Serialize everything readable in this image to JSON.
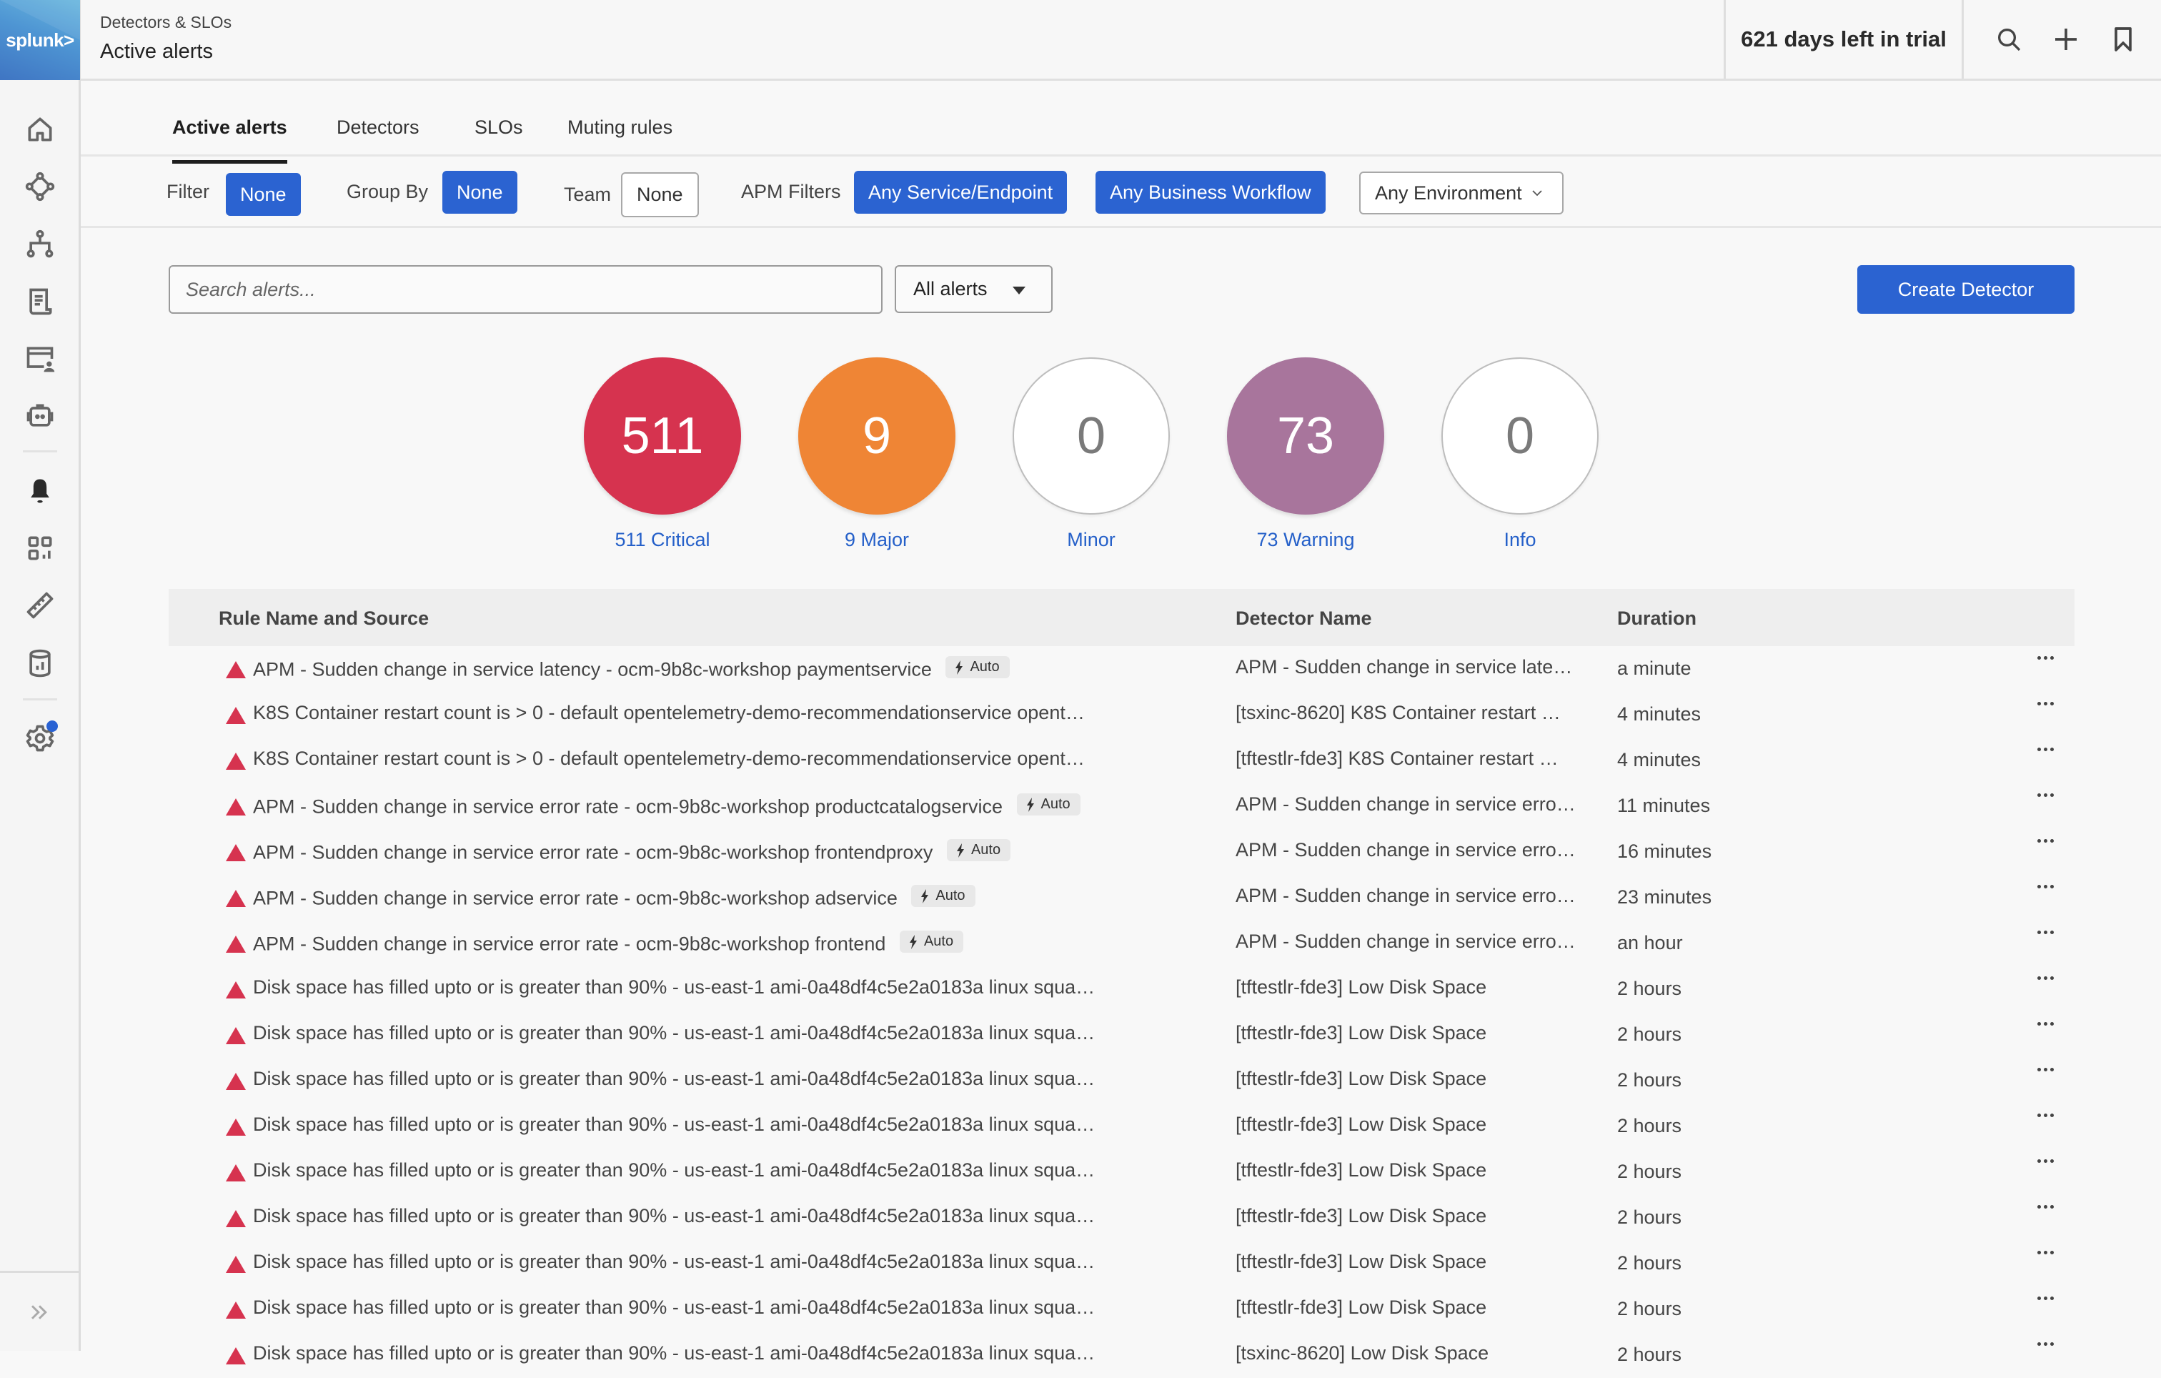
{
  "app": {
    "logo_text": "splunk>",
    "breadcrumb": "Detectors & SLOs",
    "page_title": "Active alerts",
    "trial_text": "621 days left in trial"
  },
  "sidebar": {
    "items": [
      {
        "icon": "home-icon"
      },
      {
        "icon": "service-map-icon"
      },
      {
        "icon": "hierarchy-icon"
      },
      {
        "icon": "log-document-icon"
      },
      {
        "icon": "browser-user-icon"
      },
      {
        "icon": "robot-icon"
      },
      {
        "icon": "bell-icon",
        "active": true
      },
      {
        "icon": "dashboards-grid-icon"
      },
      {
        "icon": "ruler-icon"
      },
      {
        "icon": "database-chart-icon"
      },
      {
        "icon": "gear-icon",
        "notification": true
      }
    ],
    "expand_icon": "double-chevron-right-icon"
  },
  "top_actions": [
    "search-icon",
    "plus-icon",
    "bookmark-icon"
  ],
  "tabs": [
    {
      "label": "Active alerts",
      "active": true
    },
    {
      "label": "Detectors",
      "active": false
    },
    {
      "label": "SLOs",
      "active": false
    },
    {
      "label": "Muting rules",
      "active": false
    }
  ],
  "filters": {
    "filter_label": "Filter",
    "filter_value": "None",
    "group_by_label": "Group By",
    "group_by_value": "None",
    "team_label": "Team",
    "team_value": "None",
    "apm_label": "APM Filters",
    "service_endpoint": "Any Service/Endpoint",
    "business_workflow": "Any Business Workflow",
    "environment": "Any Environment"
  },
  "search": {
    "placeholder": "Search alerts...",
    "value": ""
  },
  "alerts_select": {
    "selected": "All alerts"
  },
  "create_detector_label": "Create Detector",
  "severity_summary": [
    {
      "name": "Critical",
      "count": "511",
      "label": "511 Critical",
      "color": "#d6334f"
    },
    {
      "name": "Major",
      "count": "9",
      "label": "9 Major",
      "color": "#ef8535"
    },
    {
      "name": "Minor",
      "count": "0",
      "label": "Minor",
      "color": "#ffffff"
    },
    {
      "name": "Warning",
      "count": "73",
      "label": "73 Warning",
      "color": "#a8759c"
    },
    {
      "name": "Info",
      "count": "0",
      "label": "Info",
      "color": "#ffffff"
    }
  ],
  "table": {
    "headers": {
      "rule": "Rule Name and Source",
      "detector": "Detector Name",
      "duration": "Duration"
    },
    "auto_label": "Auto",
    "rows": [
      {
        "rule": "APM - Sudden change in service latency - ocm-9b8c-workshop paymentservice",
        "auto": true,
        "detector": "APM - Sudden change in service late…",
        "duration": "a minute"
      },
      {
        "rule": "K8S Container restart count is > 0 - default opentelemetry-demo-recommendationservice opent…",
        "auto": false,
        "detector": "[tsxinc-8620] K8S Container restart …",
        "duration": "4 minutes"
      },
      {
        "rule": "K8S Container restart count is > 0 - default opentelemetry-demo-recommendationservice opent…",
        "auto": false,
        "detector": "[tftestlr-fde3] K8S Container restart …",
        "duration": "4 minutes"
      },
      {
        "rule": "APM - Sudden change in service error rate - ocm-9b8c-workshop productcatalogservice",
        "auto": true,
        "detector": "APM - Sudden change in service erro…",
        "duration": "11 minutes"
      },
      {
        "rule": "APM - Sudden change in service error rate - ocm-9b8c-workshop frontendproxy",
        "auto": true,
        "detector": "APM - Sudden change in service erro…",
        "duration": "16 minutes"
      },
      {
        "rule": "APM - Sudden change in service error rate - ocm-9b8c-workshop adservice",
        "auto": true,
        "detector": "APM - Sudden change in service erro…",
        "duration": "23 minutes"
      },
      {
        "rule": "APM - Sudden change in service error rate - ocm-9b8c-workshop frontend",
        "auto": true,
        "detector": "APM - Sudden change in service erro…",
        "duration": "an hour"
      },
      {
        "rule": "Disk space has filled upto or is greater than 90% - us-east-1 ami-0a48df4c5e2a0183a linux squa…",
        "auto": false,
        "detector": "[tftestlr-fde3] Low Disk Space",
        "duration": "2 hours"
      },
      {
        "rule": "Disk space has filled upto or is greater than 90% - us-east-1 ami-0a48df4c5e2a0183a linux squa…",
        "auto": false,
        "detector": "[tftestlr-fde3] Low Disk Space",
        "duration": "2 hours"
      },
      {
        "rule": "Disk space has filled upto or is greater than 90% - us-east-1 ami-0a48df4c5e2a0183a linux squa…",
        "auto": false,
        "detector": "[tftestlr-fde3] Low Disk Space",
        "duration": "2 hours"
      },
      {
        "rule": "Disk space has filled upto or is greater than 90% - us-east-1 ami-0a48df4c5e2a0183a linux squa…",
        "auto": false,
        "detector": "[tftestlr-fde3] Low Disk Space",
        "duration": "2 hours"
      },
      {
        "rule": "Disk space has filled upto or is greater than 90% - us-east-1 ami-0a48df4c5e2a0183a linux squa…",
        "auto": false,
        "detector": "[tftestlr-fde3] Low Disk Space",
        "duration": "2 hours"
      },
      {
        "rule": "Disk space has filled upto or is greater than 90% - us-east-1 ami-0a48df4c5e2a0183a linux squa…",
        "auto": false,
        "detector": "[tftestlr-fde3] Low Disk Space",
        "duration": "2 hours"
      },
      {
        "rule": "Disk space has filled upto or is greater than 90% - us-east-1 ami-0a48df4c5e2a0183a linux squa…",
        "auto": false,
        "detector": "[tftestlr-fde3] Low Disk Space",
        "duration": "2 hours"
      },
      {
        "rule": "Disk space has filled upto or is greater than 90% - us-east-1 ami-0a48df4c5e2a0183a linux squa…",
        "auto": false,
        "detector": "[tftestlr-fde3] Low Disk Space",
        "duration": "2 hours"
      },
      {
        "rule": "Disk space has filled upto or is greater than 90% - us-east-1 ami-0a48df4c5e2a0183a linux squa…",
        "auto": false,
        "detector": "[tsxinc-8620] Low Disk Space",
        "duration": "2 hours"
      }
    ]
  }
}
